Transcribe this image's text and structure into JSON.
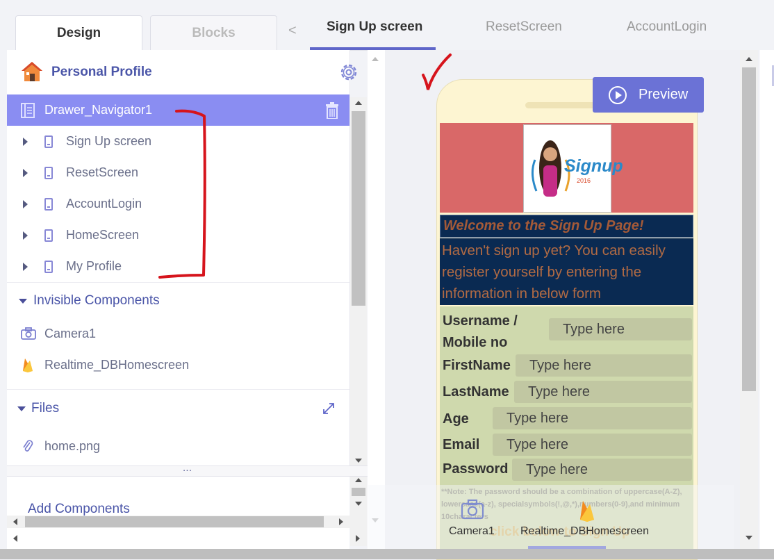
{
  "tabs": {
    "design": "Design",
    "blocks": "Blocks"
  },
  "screen_tabs": [
    "Sign Up screen",
    "ResetScreen",
    "AccountLogin"
  ],
  "colors": {
    "accent": "#5f66c9",
    "selected": "#8a8df2",
    "header_bg": "#d96868",
    "banner_bg": "#0a2a52",
    "form_bg": "#cfd9ad",
    "form_field": "#c1c7a2",
    "annotation": "#d6141c"
  },
  "project": {
    "title": "Personal Profile",
    "icon": "house-icon"
  },
  "tree": {
    "selected": "Drawer_Navigator1",
    "screens": [
      "Sign Up screen",
      "ResetScreen",
      "AccountLogin",
      "HomeScreen",
      "My Profile"
    ]
  },
  "invisible": {
    "title": "Invisible Components",
    "items": [
      {
        "label": "Camera1",
        "icon": "camera-icon"
      },
      {
        "label": "Realtime_DBHomescreen",
        "icon": "firebase-icon"
      }
    ]
  },
  "files": {
    "title": "Files",
    "items": [
      "home.png"
    ]
  },
  "splitter": "...",
  "add_components": "Add Components",
  "preview": {
    "label": "Preview"
  },
  "phone": {
    "logo_text": "Signup",
    "logo_sub": "2016",
    "welcome": "Welcome to the Sign Up Page!",
    "intro": "Haven't sign up yet? You can easily register yourself by entering the information in below form",
    "fields": [
      {
        "label": "Username /",
        "label2": "Mobile no",
        "placeholder": "Type here"
      },
      {
        "label": "FirstName",
        "placeholder": "Type here"
      },
      {
        "label": "LastName",
        "placeholder": "Type here"
      },
      {
        "label": "Age",
        "placeholder": "Type here"
      },
      {
        "label": "Email",
        "placeholder": "Type here"
      },
      {
        "label": "Password",
        "placeholder": "Type here"
      }
    ],
    "note": "**Note: The password should be a combination of uppercase(A-Z), lowercase(a-z), specialsymbols(!,@,*),numbers(0-9),and minimum 10characters",
    "cta": "click below to Sign Up"
  },
  "nonvisible_tray": [
    {
      "label": "Camera1",
      "icon": "camera-icon"
    },
    {
      "label": "Realtime_DBHomescreen",
      "icon": "firebase-icon"
    }
  ]
}
